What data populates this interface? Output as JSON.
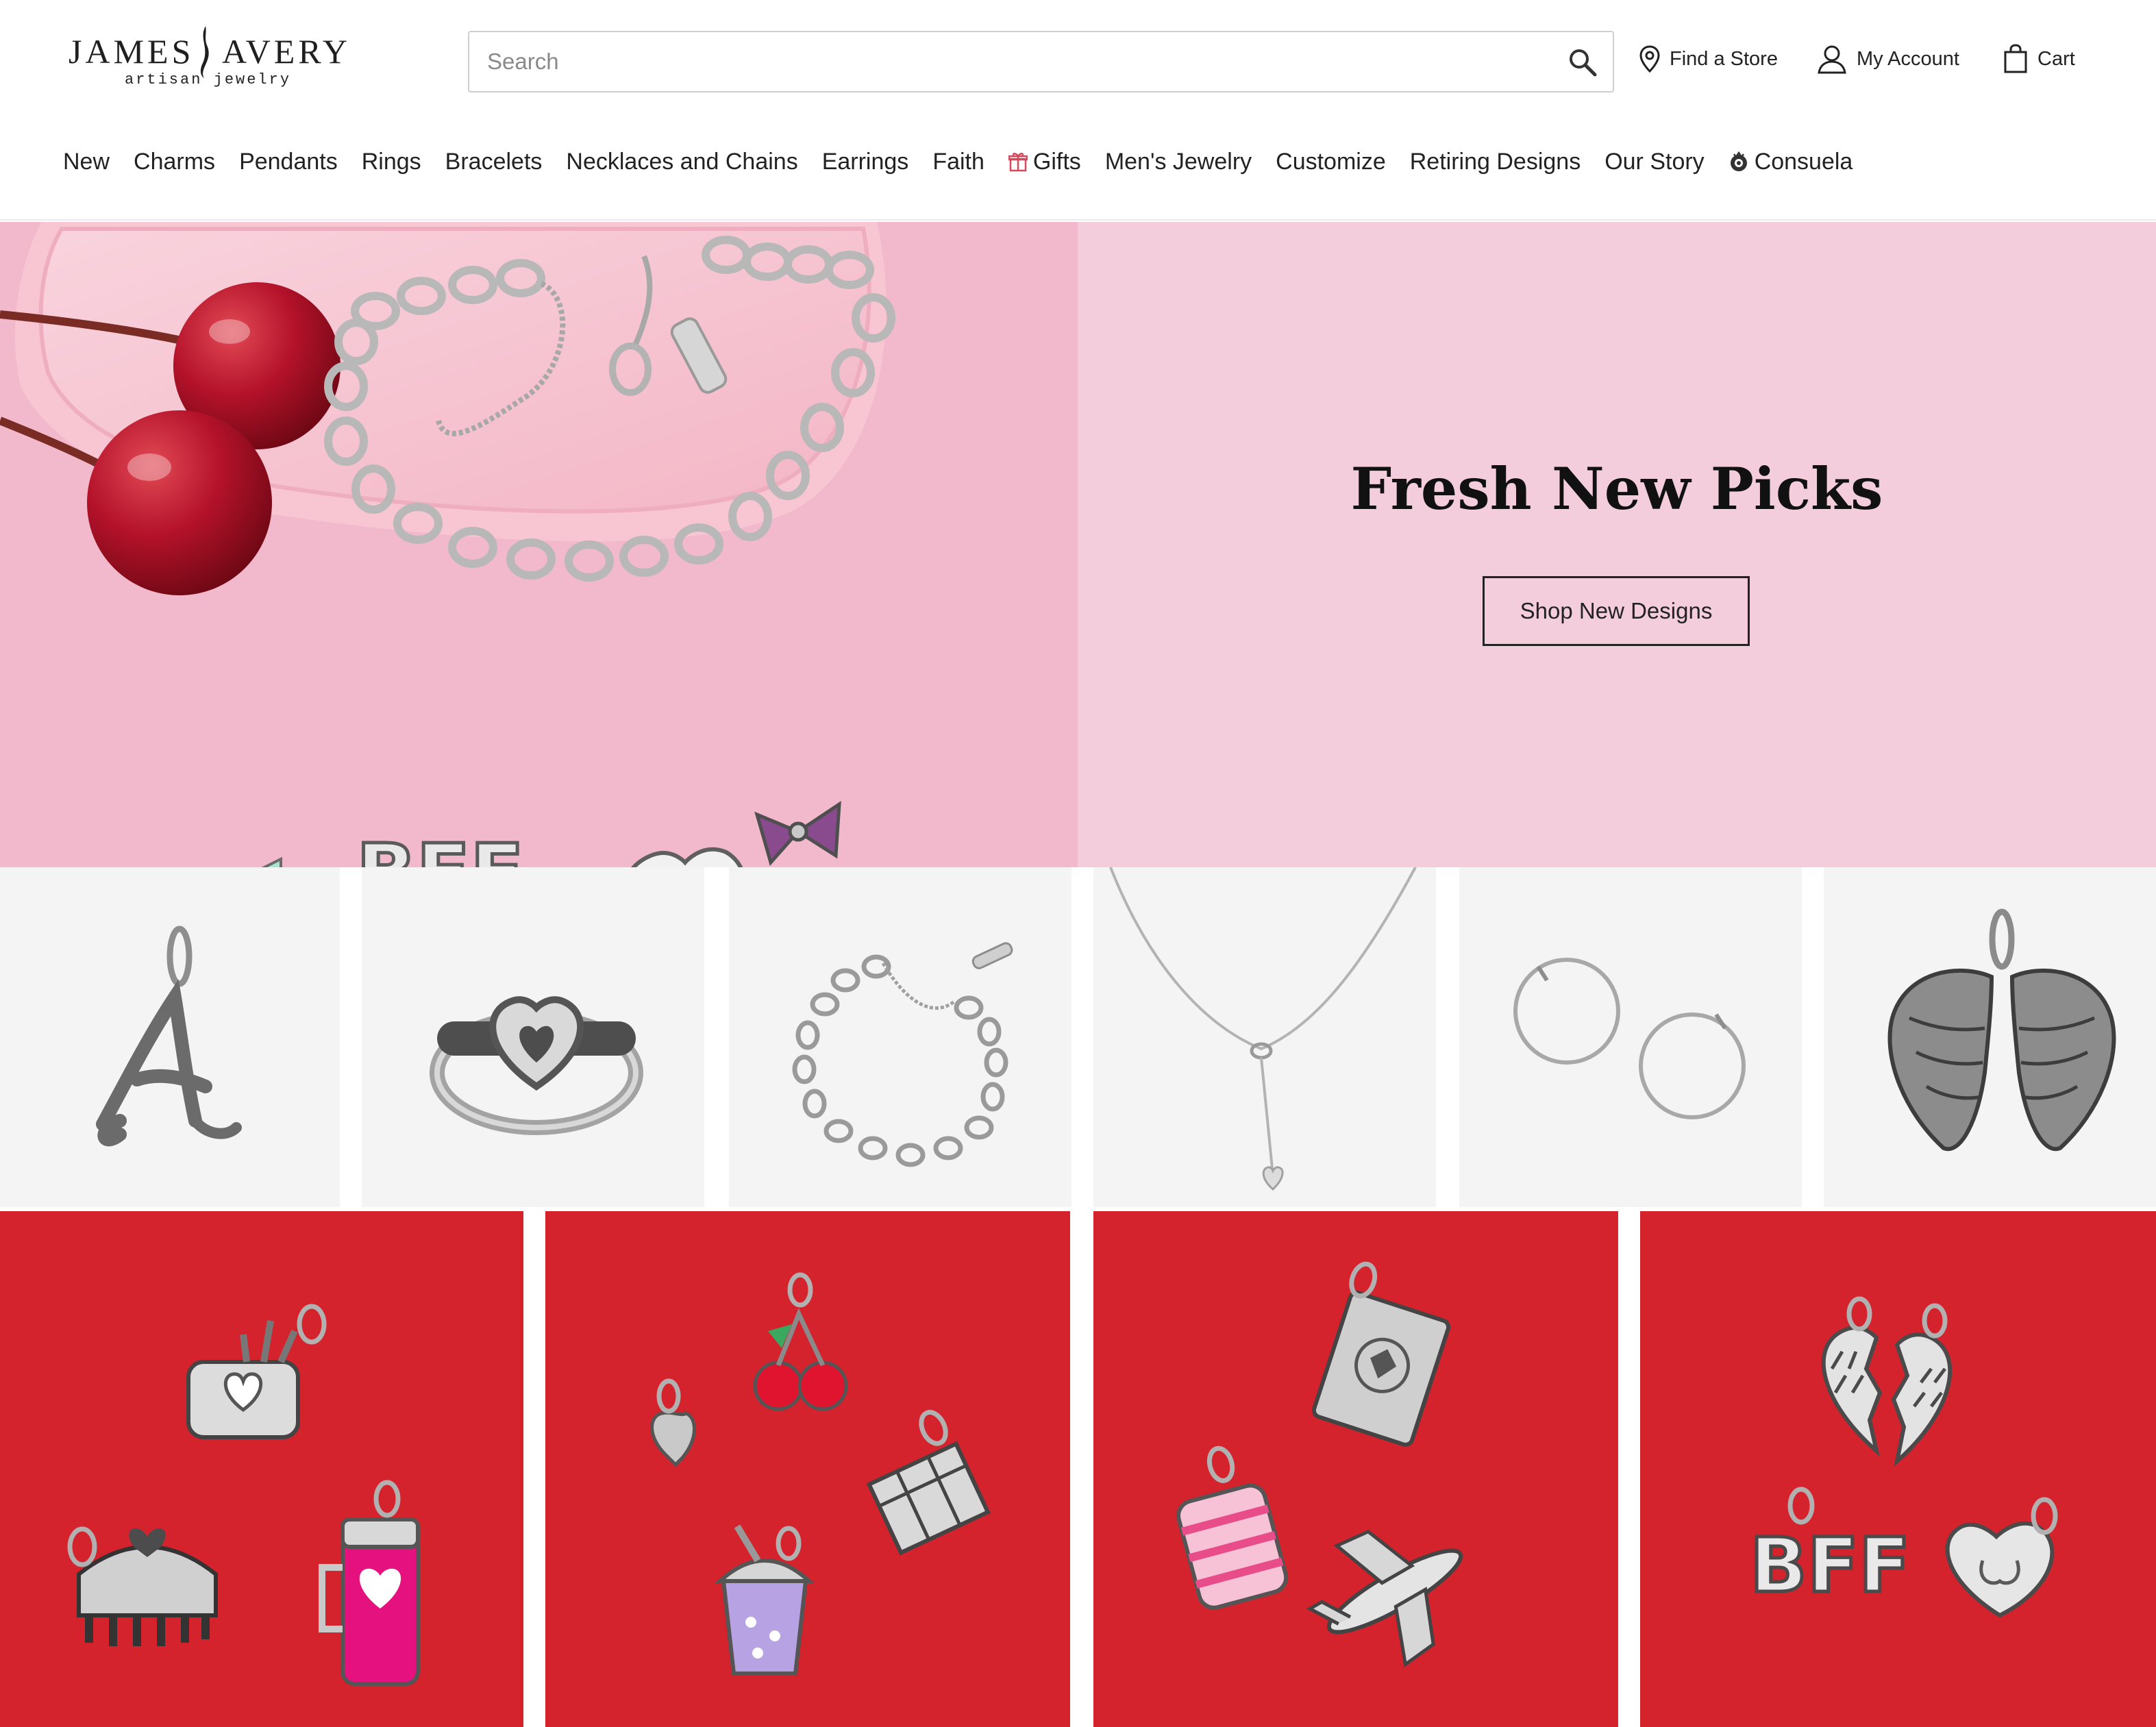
{
  "brand": {
    "name_left": "JAMES",
    "name_right": "AVERY",
    "tagline": "artisan jewelry"
  },
  "search": {
    "placeholder": "Search"
  },
  "utility": {
    "find_store": "Find a Store",
    "my_account": "My Account",
    "cart": "Cart"
  },
  "nav": {
    "items": [
      {
        "label": "New",
        "icon": ""
      },
      {
        "label": "Charms",
        "icon": ""
      },
      {
        "label": "Pendants",
        "icon": ""
      },
      {
        "label": "Rings",
        "icon": ""
      },
      {
        "label": "Bracelets",
        "icon": ""
      },
      {
        "label": "Necklaces and Chains",
        "icon": ""
      },
      {
        "label": "Earrings",
        "icon": ""
      },
      {
        "label": "Faith",
        "icon": ""
      },
      {
        "label": "Gifts",
        "icon": "gift-icon"
      },
      {
        "label": "Men's Jewelry",
        "icon": ""
      },
      {
        "label": "Customize",
        "icon": ""
      },
      {
        "label": "Retiring Designs",
        "icon": ""
      },
      {
        "label": "Our Story",
        "icon": ""
      },
      {
        "label": "Consuela",
        "icon": "consuela-logo-icon"
      }
    ]
  },
  "hero": {
    "title": "Fresh New Picks",
    "cta": "Shop New Designs"
  },
  "colors": {
    "hero_pink": "#f3cddb",
    "hero_photo_pink": "#f2b8cc",
    "tile_gray": "#f4f4f4",
    "charm_red": "#d9272e",
    "gift_icon_red": "#d9475a"
  }
}
